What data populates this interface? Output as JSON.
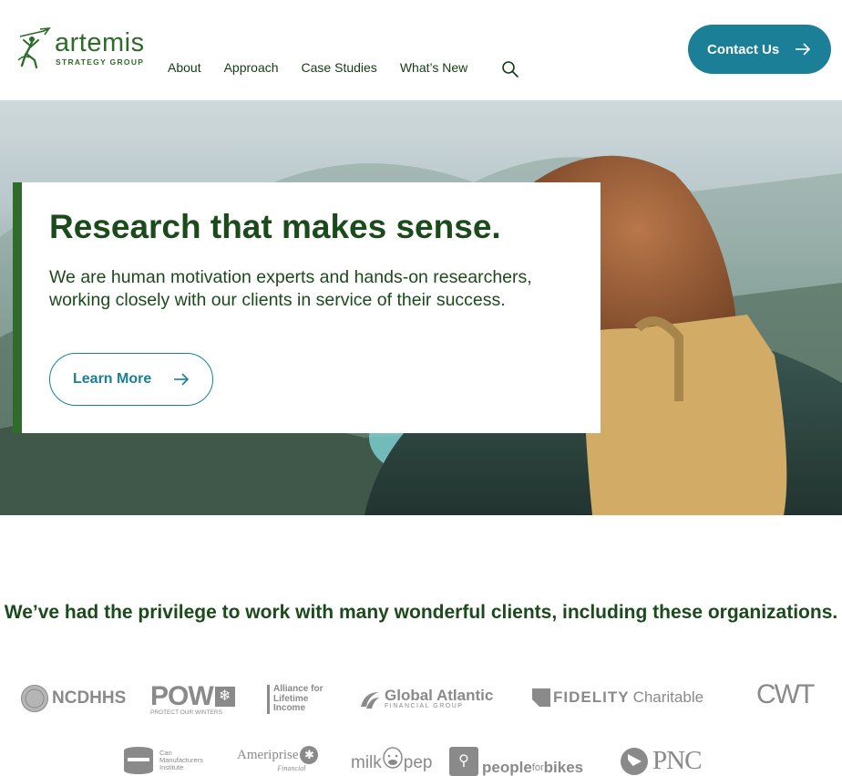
{
  "brand": {
    "name": "artemis",
    "tagline": "STRATEGY GROUP",
    "colors": {
      "green": "#2e6b2a",
      "dark_green": "#1b4a1b",
      "teal": "#1a7f97",
      "logo_gray": "#8a8a8a"
    }
  },
  "nav": {
    "items": [
      {
        "label": "About"
      },
      {
        "label": "Approach"
      },
      {
        "label": "Case Studies"
      },
      {
        "label": "What’s New"
      }
    ],
    "search_icon": "search-icon",
    "contact_label": "Contact Us",
    "contact_icon": "arrow-right-icon"
  },
  "hero": {
    "title": "Research that makes sense.",
    "body": "We are human motivation experts and hands-on researchers, working closely with our clients in service of their success.",
    "cta_label": "Learn More",
    "cta_icon": "arrow-right-icon"
  },
  "clients": {
    "heading": "We’ve had the privilege to work with many wonderful clients, including these organizations.",
    "row1": [
      {
        "name": "NCDHHS"
      },
      {
        "name": "POW",
        "sub": "PROTECT OUR WINTERS"
      },
      {
        "name": "Alliance for Lifetime Income",
        "lines": [
          "Alliance for",
          "Lifetime",
          "Income"
        ]
      },
      {
        "name": "Global Atlantic",
        "sub": "FINANCIAL GROUP"
      },
      {
        "name": "FIDELITY",
        "suffix": "Charitable"
      },
      {
        "name": "CWT"
      }
    ],
    "row2": [
      {
        "name": "Can Manufacturers Institute",
        "lines": [
          "Can",
          "Manufacturers",
          "Institute"
        ]
      },
      {
        "name": "Ameriprise",
        "sub": "Financial"
      },
      {
        "name": "milk",
        "suffix": "pep"
      },
      {
        "name": "peopleforbikes",
        "lead": "people",
        "mid": "for",
        "tail": "bikes"
      },
      {
        "name": "PNC"
      }
    ]
  }
}
